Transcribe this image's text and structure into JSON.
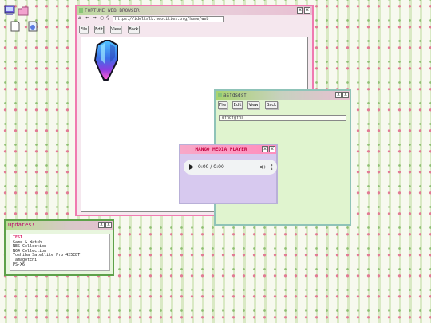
{
  "browser": {
    "title": "FORTUNE WEB BROWSER",
    "address": "https://idoltalk.neocities.org/home/web",
    "menu": {
      "file": "File",
      "edit": "Edit",
      "view": "View",
      "back": "Back"
    }
  },
  "notepad": {
    "title": "asfdsdsf",
    "menu": {
      "file": "File",
      "edit": "Edit",
      "view": "View",
      "back": "Back"
    },
    "field_value": "dfhdfgfhs"
  },
  "media_player": {
    "title": "MANGO MEDIA PLAYER",
    "time": "0:00 / 0:00"
  },
  "updates": {
    "title": "Updates!",
    "items": [
      "TEST",
      "Game & Watch",
      "NES Collection",
      "N64 Collection",
      "Toshiba Satellite Pro 425CDT",
      "Tamagotchi",
      "PS-X6"
    ]
  },
  "colors": {
    "accent_pink": "#f07ab0",
    "accent_green": "#7bbf5a",
    "player_purple": "#d7c9ef"
  }
}
